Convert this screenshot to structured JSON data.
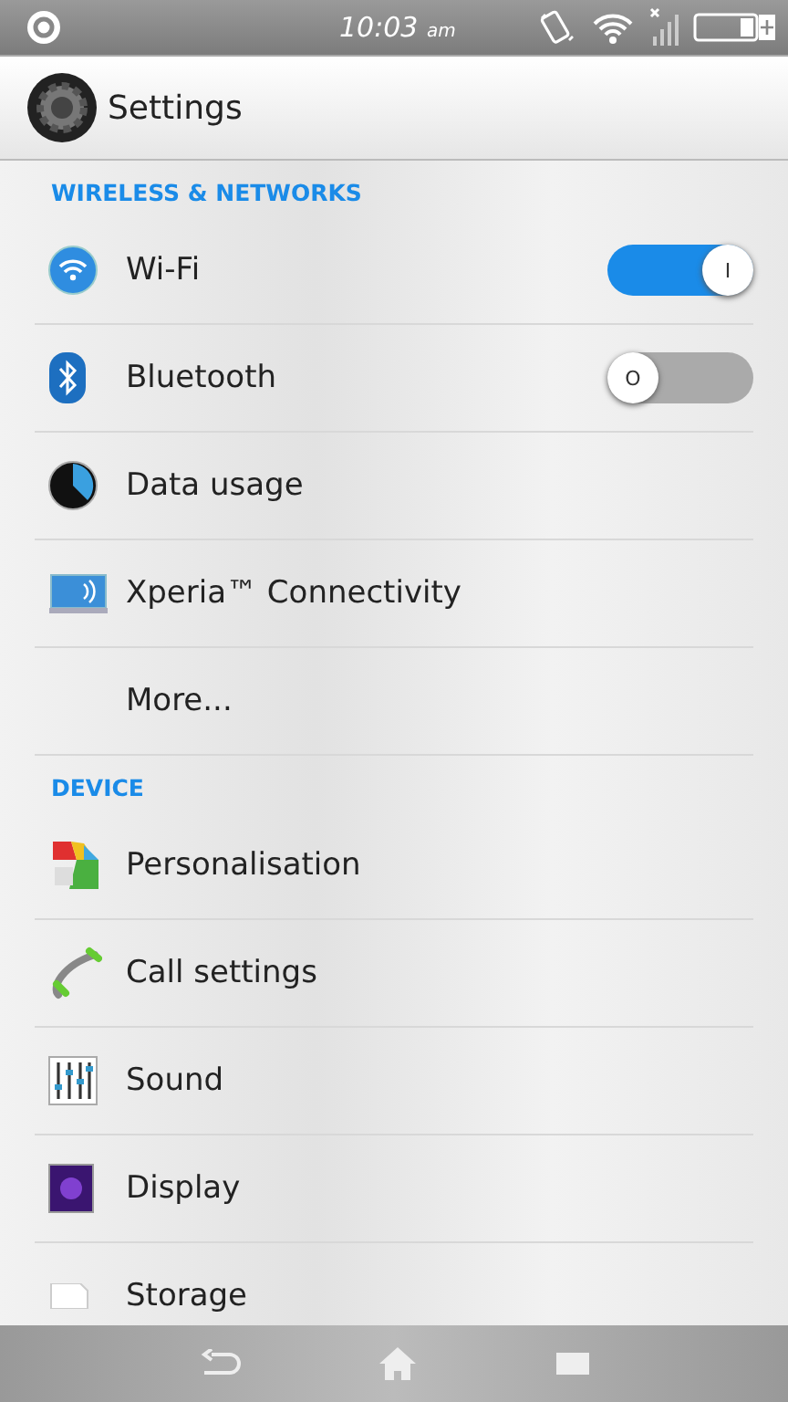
{
  "status_bar": {
    "time": "10:03",
    "meridiem": "am"
  },
  "header": {
    "title": "Settings"
  },
  "sections": [
    {
      "title": "WIRELESS & NETWORKS",
      "items": [
        {
          "label": "Wi-Fi",
          "kind": "toggle",
          "on": true,
          "knob": "I"
        },
        {
          "label": "Bluetooth",
          "kind": "toggle",
          "on": false,
          "knob": "O"
        },
        {
          "label": "Data usage",
          "kind": "link"
        },
        {
          "label": "Xperia™ Connectivity",
          "kind": "link"
        },
        {
          "label": "More...",
          "kind": "link"
        }
      ]
    },
    {
      "title": "DEVICE",
      "items": [
        {
          "label": "Personalisation",
          "kind": "link"
        },
        {
          "label": "Call settings",
          "kind": "link"
        },
        {
          "label": "Sound",
          "kind": "link"
        },
        {
          "label": "Display",
          "kind": "link"
        },
        {
          "label": "Storage",
          "kind": "link"
        }
      ]
    }
  ]
}
